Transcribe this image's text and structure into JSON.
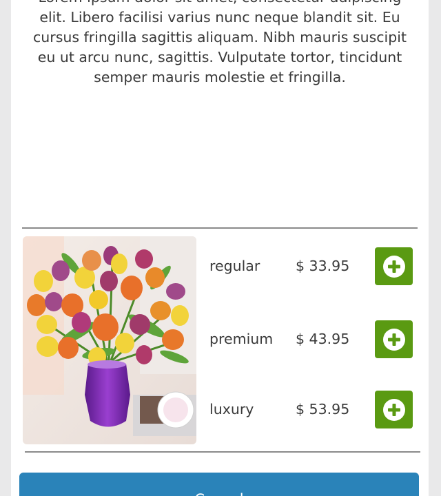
{
  "description": {
    "text": "Lorem ipsum dolor sit amet, consectetur adipiscing elit. Libero facilisi varius nunc neque blandit sit. Eu cursus fringilla sagittis aliquam. Nibh mauris suscipit eu ut arcu nunc, sagittis. Vulputate tortor, tincidunt semper mauris molestie et fringilla."
  },
  "product": {
    "image_icon": "tulip-bouquet-image",
    "options": [
      {
        "name": "regular",
        "price": "$ 33.95"
      },
      {
        "name": "premium",
        "price": "$ 43.95"
      },
      {
        "name": "luxury",
        "price": "$ 53.95"
      }
    ]
  },
  "actions": {
    "cancel_label": "Cancel"
  },
  "colors": {
    "add_button": "#5a9a12",
    "cancel_button": "#2a83b9",
    "text": "#3a3a3a"
  }
}
